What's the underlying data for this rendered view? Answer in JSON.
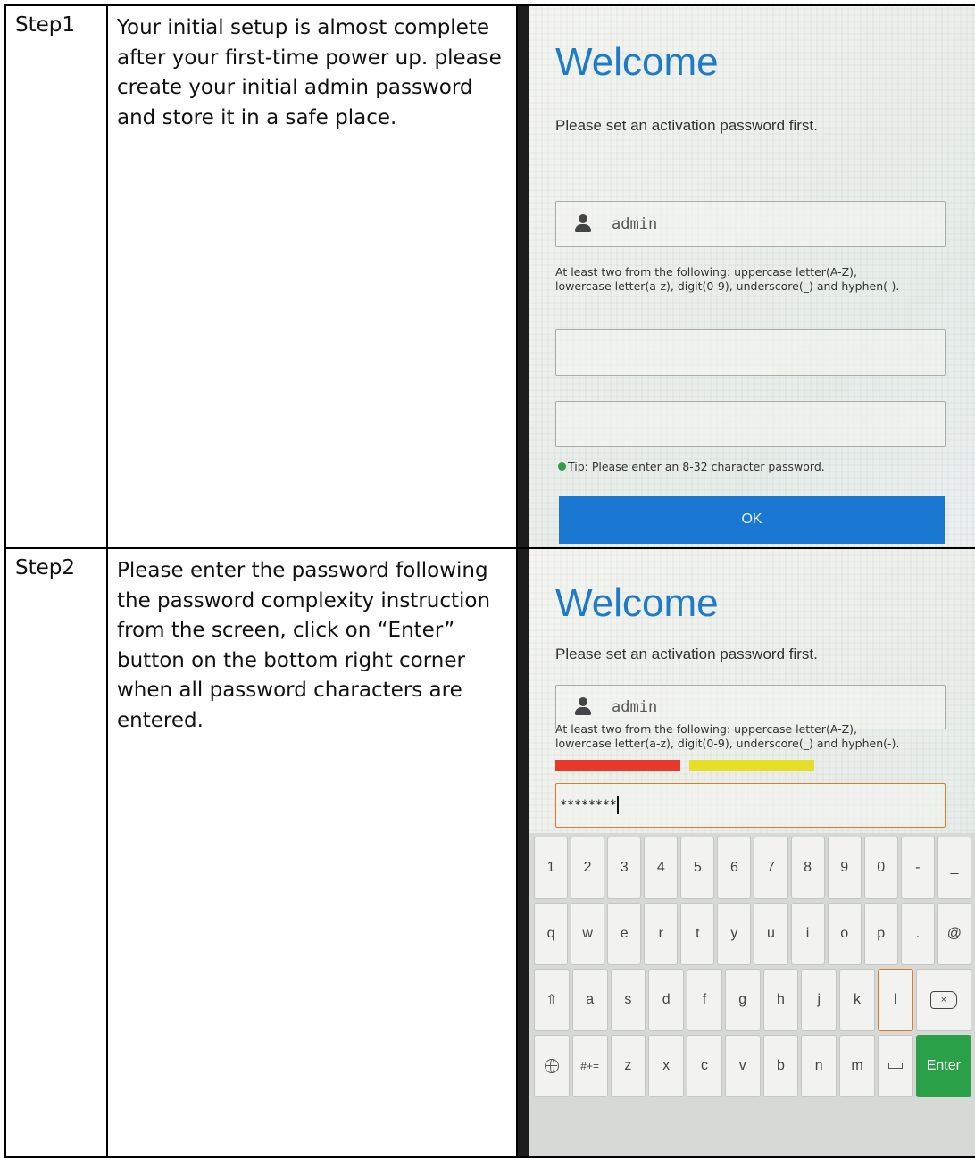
{
  "steps": [
    {
      "label": "Step1",
      "text": "Your initial setup is almost complete after your first-time power up. please create your initial admin password and store it in a safe place.",
      "screen": {
        "title": "Welcome",
        "subtitle": "Please set an activation password first.",
        "username": "admin",
        "rule_line1": "At least two from the following: uppercase letter(A-Z),",
        "rule_line2": "lowercase letter(a-z), digit(0-9), underscore(_) and hyphen(-).",
        "password": "",
        "confirm_password": "",
        "tip": "Tip: Please enter an 8-32 character password.",
        "ok_label": "OK"
      }
    },
    {
      "label": "Step2",
      "text": "Please enter the password following the password complexity instruction from the screen, click on “Enter” button on the bottom right corner when all password characters are entered.",
      "screen": {
        "title": "Welcome",
        "subtitle": "Please set an activation password first.",
        "username": "admin",
        "rule_line1": "At least two from the following: uppercase letter(A-Z),",
        "rule_line2": "lowercase letter(a-z), digit(0-9), underscore(_) and hyphen(-).",
        "password": "********",
        "keyboard": {
          "row1": [
            "1",
            "2",
            "3",
            "4",
            "5",
            "6",
            "7",
            "8",
            "9",
            "0",
            "-",
            "_"
          ],
          "row2": [
            "q",
            "w",
            "e",
            "r",
            "t",
            "y",
            "u",
            "i",
            "o",
            "p",
            ".",
            "@"
          ],
          "row3": [
            "a",
            "s",
            "d",
            "f",
            "g",
            "h",
            "j",
            "k",
            "l"
          ],
          "backspace_glyph": "×",
          "shift_glyph": "⇧",
          "symbols_label": "#+=",
          "row4": [
            "z",
            "x",
            "c",
            "v",
            "b",
            "n",
            "m"
          ],
          "enter_label": "Enter"
        }
      }
    }
  ],
  "colors": {
    "title_blue": "#1e7bc8",
    "ok_button": "#1a78d2",
    "enter_button": "#2aa048",
    "strength_weak": "#e83a2c",
    "strength_medium": "#e6dd28",
    "focus_border": "#e3782b",
    "tip_dot": "#2e9e44"
  },
  "icons": [
    "user-icon",
    "tip-dot-icon",
    "shift-icon",
    "backspace-icon",
    "globe-icon",
    "space-icon"
  ]
}
